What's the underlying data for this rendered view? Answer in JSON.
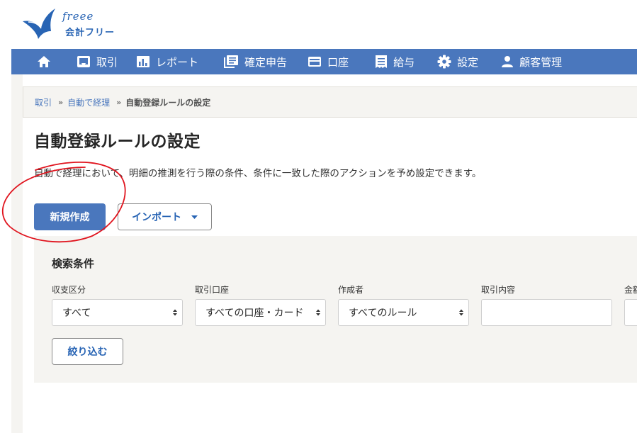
{
  "logo": {
    "script_text": "freee",
    "name": "会計フリー"
  },
  "nav": {
    "items": [
      {
        "label": "",
        "icon": "home-icon"
      },
      {
        "label": "取引",
        "icon": "inbox-icon"
      },
      {
        "label": "レポート",
        "icon": "bar-chart-icon"
      },
      {
        "label": "確定申告",
        "icon": "document-stack-icon"
      },
      {
        "label": "口座",
        "icon": "credit-card-icon"
      },
      {
        "label": "給与",
        "icon": "receipt-icon"
      },
      {
        "label": "設定",
        "icon": "gear-icon"
      },
      {
        "label": "顧客管理",
        "icon": "person-icon"
      }
    ]
  },
  "breadcrumb": {
    "items": [
      "取引",
      "自動で経理"
    ],
    "current": "自動登録ルールの設定",
    "separator": "»"
  },
  "page": {
    "title": "自動登録ルールの設定",
    "description": "自動で経理において、明細の推測を行う際の条件、条件に一致した際のアクションを予め設定できます。"
  },
  "actions": {
    "create_label": "新規作成",
    "import_label": "インポート"
  },
  "search": {
    "title": "検索条件",
    "fields": [
      {
        "label": "収支区分",
        "value": "すべて"
      },
      {
        "label": "取引口座",
        "value": "すべての口座・カード"
      },
      {
        "label": "作成者",
        "value": "すべてのルール"
      },
      {
        "label": "取引内容",
        "value": ""
      },
      {
        "label": "金額",
        "value": ""
      }
    ],
    "filter_label": "絞り込む"
  },
  "colors": {
    "nav_bg": "#4a77bd",
    "brand": "#2864b4",
    "panel_bg": "#f5f4f1",
    "annotation": "#e0141e"
  }
}
